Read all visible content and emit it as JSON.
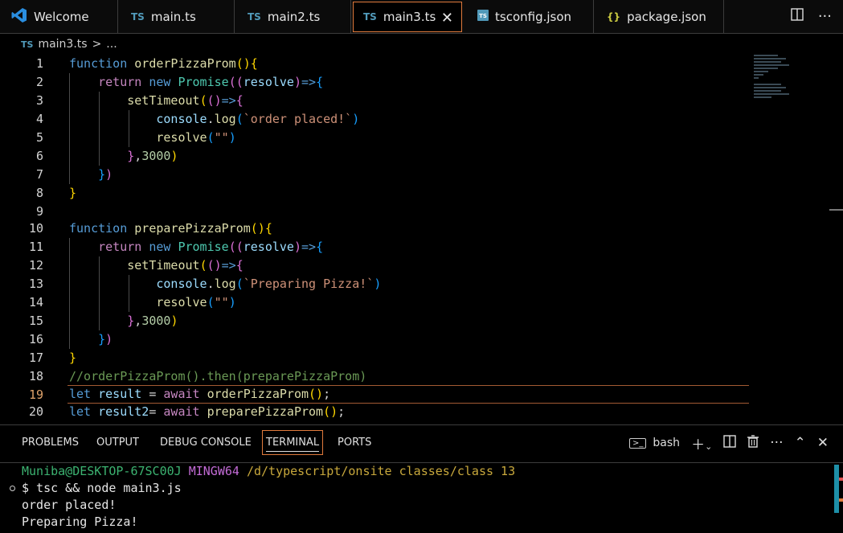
{
  "tabs": [
    {
      "name": "Welcome",
      "icon": "vscode-icon"
    },
    {
      "name": "main.ts",
      "icon": "TS"
    },
    {
      "name": "main2.ts",
      "icon": "TS"
    },
    {
      "name": "main3.ts",
      "icon": "TS",
      "active": true
    },
    {
      "name": "tsconfig.json",
      "icon": "tsconfig-icon"
    },
    {
      "name": "package.json",
      "icon": "{}"
    }
  ],
  "breadcrumb": {
    "file": "main3.ts",
    "sep": ">",
    "rest": "..."
  },
  "editor": {
    "line_numbers": [
      "1",
      "2",
      "3",
      "4",
      "5",
      "6",
      "7",
      "8",
      "9",
      "10",
      "11",
      "12",
      "13",
      "14",
      "15",
      "16",
      "17",
      "18",
      "19",
      "20"
    ],
    "current_line": 19
  },
  "panel": {
    "tabs": [
      "PROBLEMS",
      "OUTPUT",
      "DEBUG CONSOLE",
      "TERMINAL",
      "PORTS"
    ],
    "active_tab": "TERMINAL",
    "shell": "bash"
  },
  "terminal": {
    "prompt_user": "Muniba@DESKTOP-67SC00J",
    "prompt_env": "MINGW64",
    "prompt_path": "/d/typescript/onsite classes/class 13",
    "command": "$ tsc && node main3.js",
    "output": [
      "order placed!",
      "Preparing Pizza!"
    ]
  },
  "colors": {
    "accent": "#e07a3c",
    "ts": "#519aba",
    "keyword": "#569cd6"
  }
}
